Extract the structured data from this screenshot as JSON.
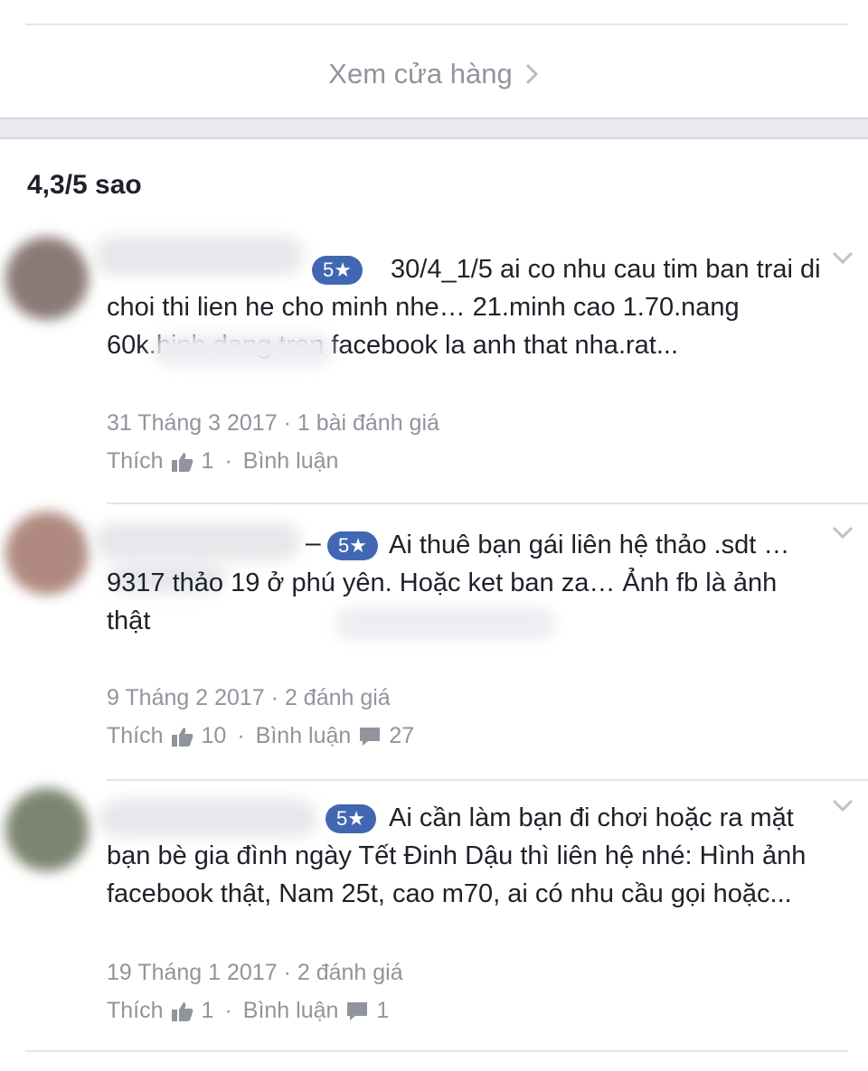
{
  "store_link": {
    "label": "Xem cửa hàng",
    "icon": "chevron-right-icon"
  },
  "rating_summary": "4,3/5 sao",
  "reviews": [
    {
      "badge": "5★",
      "dash": "",
      "text": "30/4_1/5 ai co nhu cau tim ban trai di choi thi lien he cho minh nhe… 21.minh cao 1.70.nang 60k.hinh dang tren facebook la anh that nha.rat...",
      "date": "31 Tháng 3 2017",
      "review_count": "1 bài đánh giá",
      "like_label": "Thích",
      "like_count": "1",
      "comment_label": "Bình luận",
      "comment_count": "",
      "avatar_color": "#8a7a76"
    },
    {
      "badge": "5★",
      "dash": "–",
      "text": "Ai thuê bạn gái liên hệ thảo .sdt …9317 thảo 19 ở phú yên. Hoặc ket ban za… Ảnh fb là ảnh thật",
      "date": "9 Tháng 2 2017",
      "review_count": "2 đánh giá",
      "like_label": "Thích",
      "like_count": "10",
      "comment_label": "Bình luận",
      "comment_count": "27",
      "avatar_color": "#b08a80"
    },
    {
      "badge": "5★",
      "dash": "",
      "text": "Ai cần làm bạn đi chơi hoặc ra mặt bạn bè gia đình ngày Tết Đinh Dậu thì liên hệ nhé: Hình ảnh facebook thật, Nam 25t, cao m70, ai có nhu cầu gọi hoặc...",
      "date": "19 Tháng 1 2017",
      "review_count": "2 đánh giá",
      "like_label": "Thích",
      "like_count": "1",
      "comment_label": "Bình luận",
      "comment_count": "1",
      "avatar_color": "#7d8570"
    }
  ],
  "colors": {
    "badge": "#4267b2",
    "meta": "#90949c",
    "text": "#1d2129",
    "separator": "#e9ebee"
  }
}
